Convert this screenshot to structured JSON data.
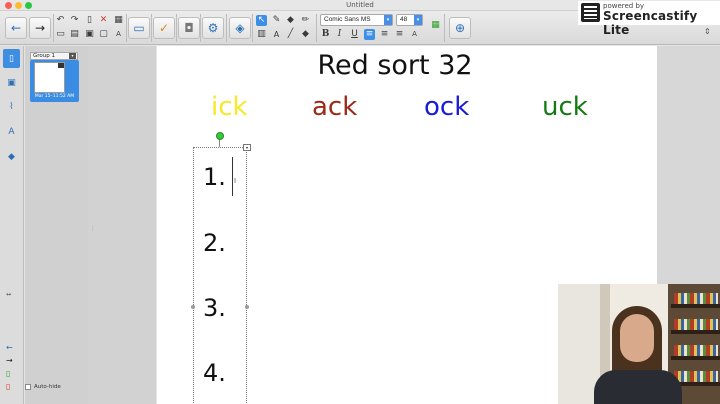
{
  "window": {
    "title": "Untitled"
  },
  "screencastify": {
    "powered_by": "powered by",
    "brand": "Screencastify Lite"
  },
  "toolbar": {
    "font_name": "Comic Sans MS",
    "font_size": "48"
  },
  "sorter": {
    "group_label": "Group 1",
    "thumb_date": "Mar 15–11:52 AM",
    "autohide_label": "Auto-hide"
  },
  "page": {
    "title": "Red sort 32",
    "words": [
      "ick",
      "ack",
      "ock",
      "uck"
    ],
    "numbers": [
      "1.",
      "2.",
      "3.",
      "4."
    ]
  },
  "colors": {
    "ick": "#f5e92a",
    "ack": "#9c2a19",
    "ock": "#1b1bd6",
    "uck": "#147a14",
    "accent": "#3d8ee6"
  }
}
